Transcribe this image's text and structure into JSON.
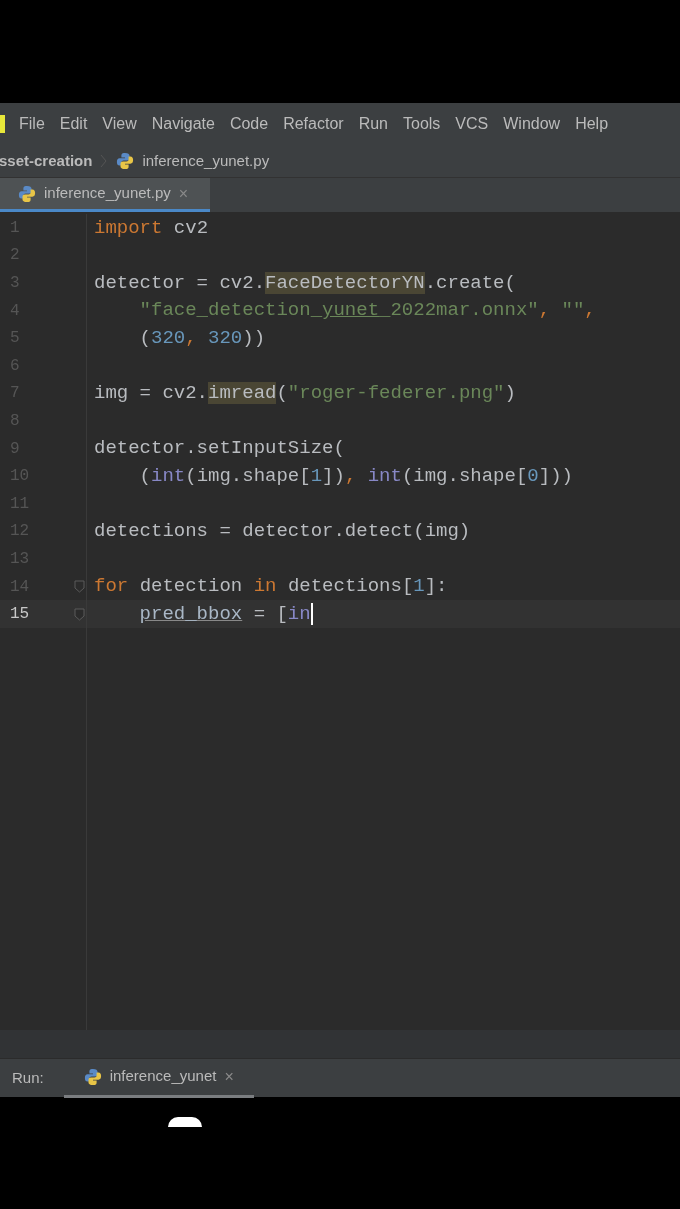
{
  "menu_bar": {
    "items": [
      "File",
      "Edit",
      "View",
      "Navigate",
      "Code",
      "Refactor",
      "Run",
      "Tools",
      "VCS",
      "Window",
      "Help"
    ]
  },
  "breadcrumb": {
    "project": "sset-creation",
    "file": "inference_yunet.py"
  },
  "editor_tabs": [
    {
      "label": "inference_yunet.py",
      "close": "×",
      "selected": true
    }
  ],
  "editor": {
    "lines": [
      {
        "number": "1",
        "current": false,
        "tokens": [
          {
            "kind": "keyword",
            "text": "import"
          },
          {
            "kind": "plain",
            "text": " cv2"
          }
        ]
      },
      {
        "number": "2",
        "current": false
      },
      {
        "number": "3",
        "current": false,
        "tokens": [
          {
            "kind": "plain",
            "text": "detector = cv2."
          },
          {
            "kind": "highlight",
            "text": "FaceDetectorYN"
          },
          {
            "kind": "plain",
            "text": ".create("
          }
        ]
      },
      {
        "number": "4",
        "current": false,
        "tokens": [
          {
            "kind": "string",
            "text": "    \"face_detection_"
          },
          {
            "kind": "string_typo",
            "text": "yunet"
          },
          {
            "kind": "string",
            "text": "_2022mar.onnx\""
          },
          {
            "kind": "keyword",
            "text": ", "
          },
          {
            "kind": "string",
            "text": "\"\""
          },
          {
            "kind": "keyword",
            "text": ","
          }
        ]
      },
      {
        "number": "5",
        "current": false,
        "tokens": [
          {
            "kind": "plain",
            "text": "    ("
          },
          {
            "kind": "number",
            "text": "320"
          },
          {
            "kind": "keyword",
            "text": ", "
          },
          {
            "kind": "number",
            "text": "320"
          },
          {
            "kind": "plain",
            "text": "))"
          }
        ]
      },
      {
        "number": "6",
        "current": false
      },
      {
        "number": "7",
        "current": false,
        "tokens": [
          {
            "kind": "plain",
            "text": "img = cv2."
          },
          {
            "kind": "highlight",
            "text": "imread"
          },
          {
            "kind": "plain",
            "text": "("
          },
          {
            "kind": "string",
            "text": "\"roger-federer.png\""
          },
          {
            "kind": "plain",
            "text": ")"
          }
        ]
      },
      {
        "number": "8",
        "current": false
      },
      {
        "number": "9",
        "current": false,
        "tokens": [
          {
            "kind": "plain",
            "text": "detector.setInputSize("
          }
        ]
      },
      {
        "number": "10",
        "current": false,
        "tokens": [
          {
            "kind": "plain",
            "text": "    ("
          },
          {
            "kind": "builtin",
            "text": "int"
          },
          {
            "kind": "plain",
            "text": "(img.shape["
          },
          {
            "kind": "number",
            "text": "1"
          },
          {
            "kind": "plain",
            "text": "])"
          },
          {
            "kind": "keyword",
            "text": ", "
          },
          {
            "kind": "builtin",
            "text": "int"
          },
          {
            "kind": "plain",
            "text": "(img.shape["
          },
          {
            "kind": "number",
            "text": "0"
          },
          {
            "kind": "plain",
            "text": "]))"
          }
        ]
      },
      {
        "number": "11",
        "current": false
      },
      {
        "number": "12",
        "current": false,
        "tokens": [
          {
            "kind": "plain",
            "text": "detections = detector.detect(img)"
          }
        ]
      },
      {
        "number": "13",
        "current": false
      },
      {
        "number": "14",
        "current": false,
        "fold": true,
        "tokens": [
          {
            "kind": "keyword",
            "text": "for"
          },
          {
            "kind": "plain",
            "text": " detection "
          },
          {
            "kind": "keyword",
            "text": "in"
          },
          {
            "kind": "plain",
            "text": " detections["
          },
          {
            "kind": "number",
            "text": "1"
          },
          {
            "kind": "plain",
            "text": "]:"
          }
        ]
      },
      {
        "number": "15",
        "current": true,
        "fold": true,
        "tokens": [
          {
            "kind": "plain_typo",
            "text": "    pred_bbox"
          },
          {
            "kind": "plain",
            "text": " = ["
          },
          {
            "kind": "builtin",
            "text": "in"
          }
        ]
      }
    ]
  },
  "run_bar": {
    "label": "Run:",
    "tabs": [
      {
        "label": "inference_yunet",
        "close": "×",
        "selected": true
      }
    ]
  }
}
